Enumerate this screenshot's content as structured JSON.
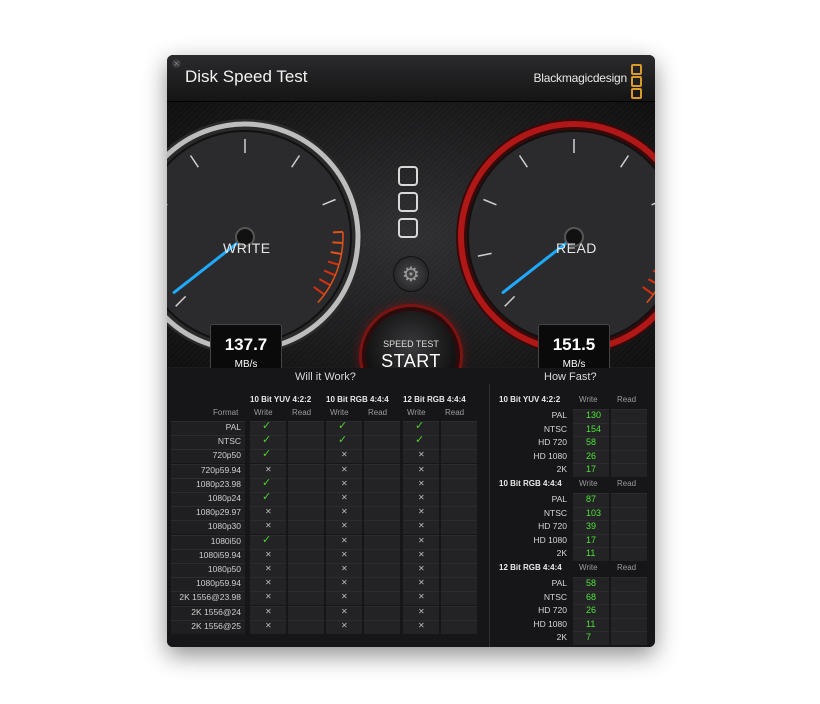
{
  "window": {
    "title": "Disk Speed Test",
    "brand": "Blackmagicdesign",
    "close_glyph": "×"
  },
  "gauges": {
    "write": {
      "label": "WRITE",
      "value": "137.7",
      "unit": "MB/s"
    },
    "read": {
      "label": "READ",
      "value": "151.5",
      "unit": "MB/s"
    }
  },
  "start_button": {
    "small_label": "SPEED TEST",
    "big_label": "START"
  },
  "will_it_work": {
    "title": "Will it Work?",
    "format_header": "Format",
    "groups": [
      "10 Bit YUV 4:2:2",
      "10 Bit RGB 4:4:4",
      "12 Bit RGB 4:4:4"
    ],
    "sub_headers": [
      "Write",
      "Read"
    ],
    "rows": [
      {
        "format": "PAL",
        "yuv_w": true,
        "rgb10_w": true,
        "rgb12_w": true
      },
      {
        "format": "NTSC",
        "yuv_w": true,
        "rgb10_w": true,
        "rgb12_w": true
      },
      {
        "format": "720p50",
        "yuv_w": true,
        "rgb10_w": false,
        "rgb12_w": false
      },
      {
        "format": "720p59.94",
        "yuv_w": false,
        "rgb10_w": false,
        "rgb12_w": false
      },
      {
        "format": "1080p23.98",
        "yuv_w": true,
        "rgb10_w": false,
        "rgb12_w": false
      },
      {
        "format": "1080p24",
        "yuv_w": true,
        "rgb10_w": false,
        "rgb12_w": false
      },
      {
        "format": "1080p29.97",
        "yuv_w": false,
        "rgb10_w": false,
        "rgb12_w": false
      },
      {
        "format": "1080p30",
        "yuv_w": false,
        "rgb10_w": false,
        "rgb12_w": false
      },
      {
        "format": "1080i50",
        "yuv_w": true,
        "rgb10_w": false,
        "rgb12_w": false
      },
      {
        "format": "1080i59.94",
        "yuv_w": false,
        "rgb10_w": false,
        "rgb12_w": false
      },
      {
        "format": "1080p50",
        "yuv_w": false,
        "rgb10_w": false,
        "rgb12_w": false
      },
      {
        "format": "1080p59.94",
        "yuv_w": false,
        "rgb10_w": false,
        "rgb12_w": false
      },
      {
        "format": "2K 1556@23.98",
        "yuv_w": false,
        "rgb10_w": false,
        "rgb12_w": false
      },
      {
        "format": "2K 1556@24",
        "yuv_w": false,
        "rgb10_w": false,
        "rgb12_w": false
      },
      {
        "format": "2K 1556@25",
        "yuv_w": false,
        "rgb10_w": false,
        "rgb12_w": false
      }
    ],
    "check_glyph": "✓",
    "cross_glyph": "✕"
  },
  "how_fast": {
    "title": "How Fast?",
    "sub_headers": [
      "Write",
      "Read"
    ],
    "groups": [
      {
        "name": "10 Bit YUV 4:2:2",
        "rows": [
          {
            "format": "PAL",
            "write": "130"
          },
          {
            "format": "NTSC",
            "write": "154"
          },
          {
            "format": "HD 720",
            "write": "58"
          },
          {
            "format": "HD 1080",
            "write": "26"
          },
          {
            "format": "2K",
            "write": "17"
          }
        ]
      },
      {
        "name": "10 Bit RGB 4:4:4",
        "rows": [
          {
            "format": "PAL",
            "write": "87"
          },
          {
            "format": "NTSC",
            "write": "103"
          },
          {
            "format": "HD 720",
            "write": "39"
          },
          {
            "format": "HD 1080",
            "write": "17"
          },
          {
            "format": "2K",
            "write": "11"
          }
        ]
      },
      {
        "name": "12 Bit RGB 4:4:4",
        "rows": [
          {
            "format": "PAL",
            "write": "58"
          },
          {
            "format": "NTSC",
            "write": "68"
          },
          {
            "format": "HD 720",
            "write": "26"
          },
          {
            "format": "HD 1080",
            "write": "11"
          },
          {
            "format": "2K",
            "write": "7"
          }
        ]
      }
    ]
  },
  "colors": {
    "accent_orange": "#d89a2a",
    "needle_blue": "#1fa9ff",
    "ok_green": "#4fd12f",
    "value_green": "#4fe33a",
    "read_ring_red": "#b01818"
  }
}
